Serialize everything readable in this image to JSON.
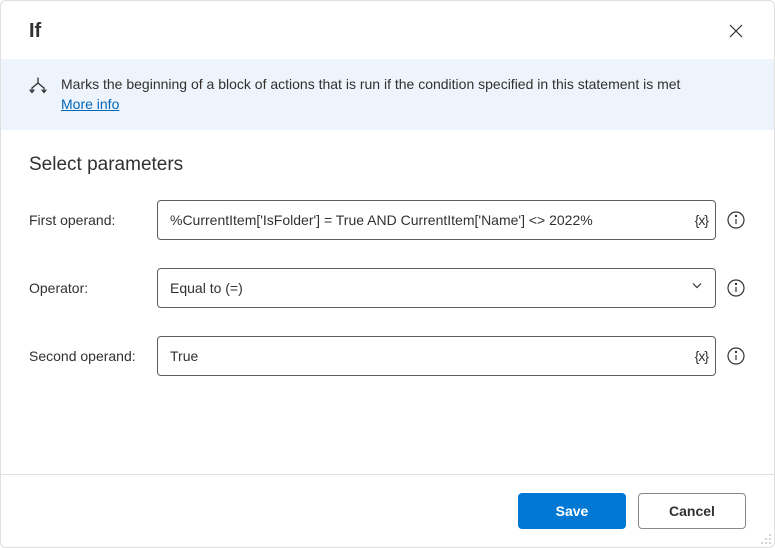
{
  "header": {
    "title": "If"
  },
  "banner": {
    "text": "Marks the beginning of a block of actions that is run if the condition specified in this statement is met",
    "link_label": "More info"
  },
  "section": {
    "title": "Select parameters"
  },
  "params": {
    "first_operand": {
      "label": "First operand:",
      "value": "%CurrentItem['IsFolder'] = True AND CurrentItem['Name'] <> 2022%"
    },
    "operator": {
      "label": "Operator:",
      "value": "Equal to (=)"
    },
    "second_operand": {
      "label": "Second operand:",
      "value": "True"
    }
  },
  "footer": {
    "save": "Save",
    "cancel": "Cancel"
  },
  "icons": {
    "variable_token": "{x}"
  }
}
